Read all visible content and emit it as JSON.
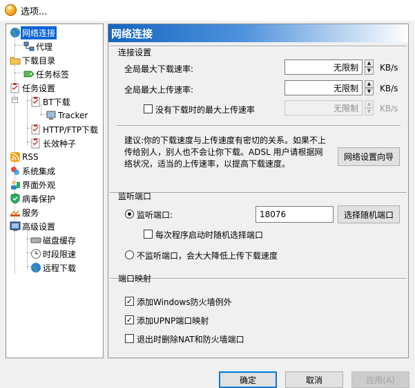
{
  "window": {
    "title": "选项..."
  },
  "tree": {
    "items": [
      {
        "label": "网络连接",
        "icon": "globe-icon",
        "selected": true
      },
      {
        "label": "代理",
        "icon": "network-icon"
      },
      {
        "label": "下载目录",
        "icon": "folder-icon"
      },
      {
        "label": "任务标签",
        "icon": "tag-icon"
      },
      {
        "label": "任务设置",
        "icon": "clipboard-icon"
      },
      {
        "label": "BT下载",
        "icon": "clipboard-icon"
      },
      {
        "label": "Tracker",
        "icon": "computer-icon"
      },
      {
        "label": "HTTP/FTP下载",
        "icon": "clipboard-icon"
      },
      {
        "label": "长效种子",
        "icon": "clipboard-icon"
      },
      {
        "label": "RSS",
        "icon": "rss-icon"
      },
      {
        "label": "系统集成",
        "icon": "integration-icon"
      },
      {
        "label": "界面外观",
        "icon": "appearance-icon"
      },
      {
        "label": "病毒保护",
        "icon": "shield-icon"
      },
      {
        "label": "服务",
        "icon": "service-icon"
      },
      {
        "label": "高级设置",
        "icon": "advanced-icon"
      },
      {
        "label": "磁盘缓存",
        "icon": "disk-icon"
      },
      {
        "label": "时段限速",
        "icon": "clock-icon"
      },
      {
        "label": "远程下载",
        "icon": "remote-globe-icon"
      }
    ]
  },
  "panel": {
    "header": "网络连接",
    "connection": {
      "group_title": "连接设置",
      "max_download_label": "全局最大下载速率:",
      "max_download_value": "无限制",
      "max_upload_label": "全局最大上传速率:",
      "max_upload_value": "无限制",
      "idle_upload_label": "没有下载时的最大上传速率",
      "idle_upload_value": "无限制",
      "unit": "KB/s",
      "advice_line1": "建议:你的下载速度与上传速度有密切的关系。如果不上",
      "advice_line2": "传给别人，别人也不会让你下载。ADSL 用户请根据网",
      "advice_line3": "络状况，适当的上传速率，以提高下载速度。",
      "wizard_button": "网络设置向导"
    },
    "listen": {
      "group_title": "监听端口",
      "listen_label": "监听端口:",
      "port_value": "18076",
      "random_button": "选择随机端口",
      "random_on_start_label": "每次程序启动时随机选择端口",
      "no_listen_label": "不监听端口，会大大降低上传下载速度"
    },
    "mapping": {
      "group_title": "端口映射",
      "firewall_label": "添加Windows防火墙例外",
      "upnp_label": "添加UPNP端口映射",
      "remove_on_exit_label": "退出时删除NAT和防火墙端口"
    }
  },
  "footer": {
    "ok": "确定",
    "cancel": "取消",
    "apply": "应用(A)"
  }
}
